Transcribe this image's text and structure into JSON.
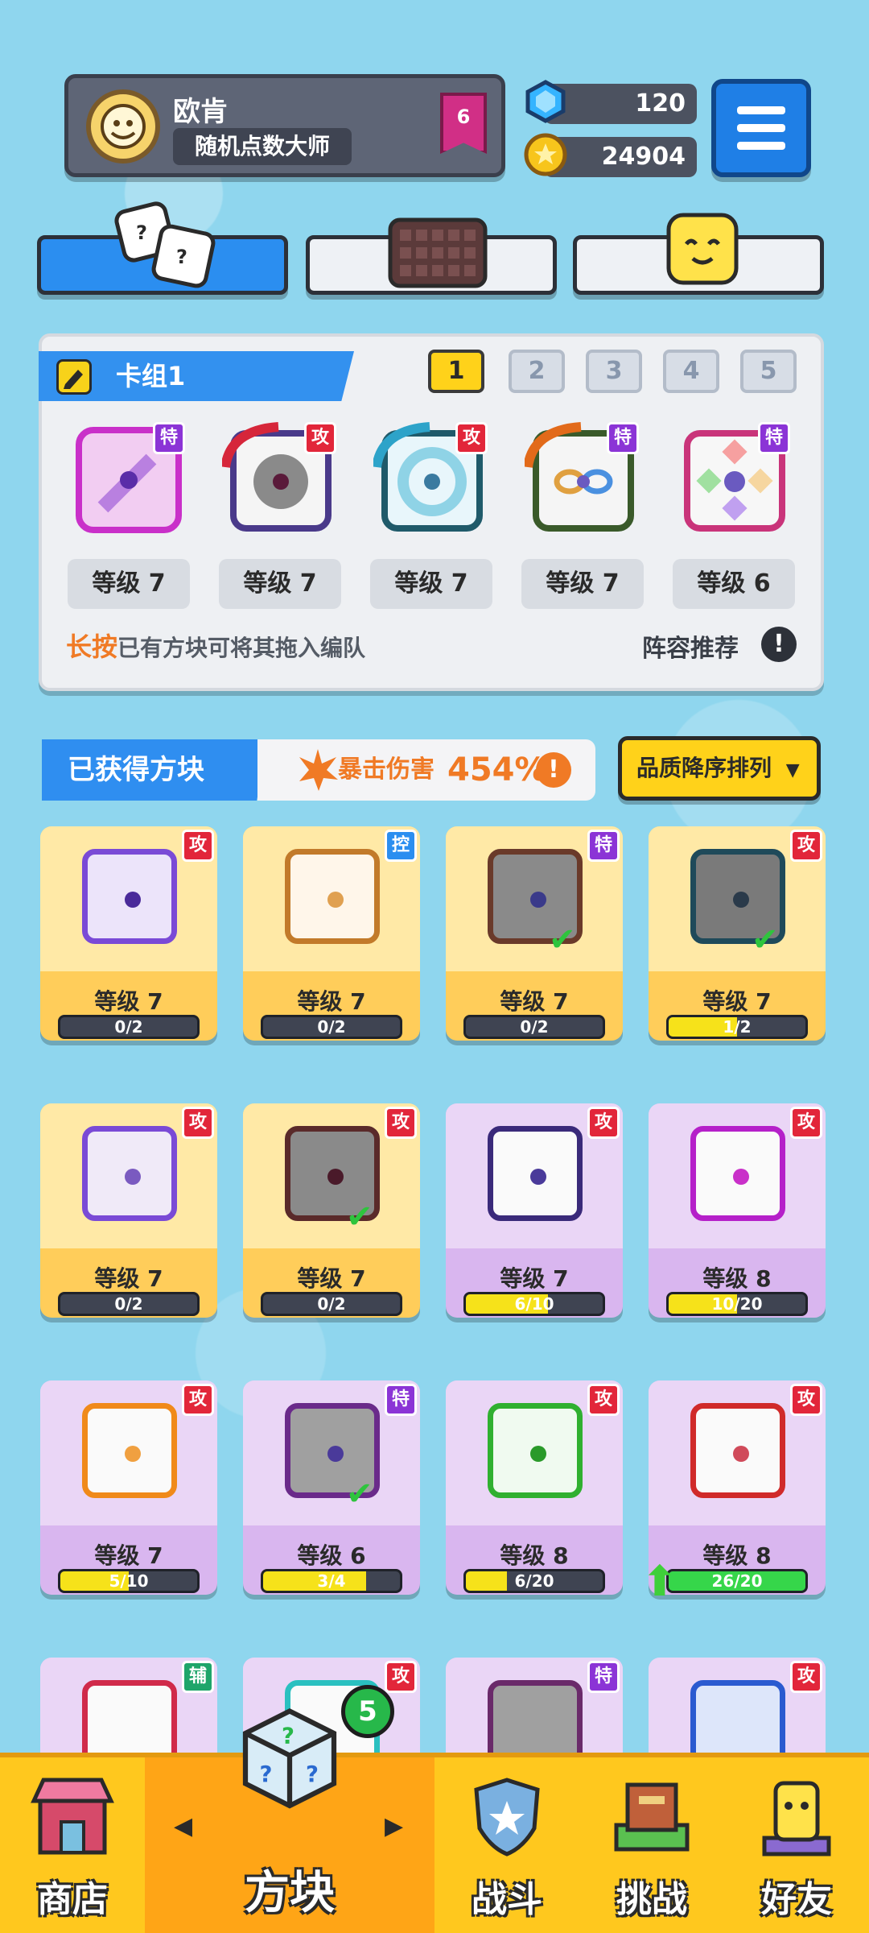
{
  "profile": {
    "name": "欧肯",
    "title": "随机点数大师",
    "rank": "6"
  },
  "currency": {
    "gems": "120",
    "gold": "24904"
  },
  "deck": {
    "title": "卡组1",
    "tabs": [
      "1",
      "2",
      "3",
      "4",
      "5"
    ],
    "active_tab": "1",
    "slots": [
      {
        "tag": "特",
        "level": "等级 7"
      },
      {
        "tag": "攻",
        "level": "等级 7"
      },
      {
        "tag": "攻",
        "level": "等级 7"
      },
      {
        "tag": "特",
        "level": "等级 7"
      },
      {
        "tag": "特",
        "level": "等级 6"
      }
    ],
    "hint_bold": "长按",
    "hint_rest": "已有方块可将其拖入编队",
    "lineup": "阵容推荐",
    "info_glyph": "!"
  },
  "obtained": {
    "title": "已获得方块",
    "crit_label": "暴击伤害",
    "crit_value": "454%",
    "info_glyph": "!",
    "sort": "品质降序排列",
    "sort_arrow": "▼"
  },
  "cards": [
    {
      "tag": "攻",
      "level": "等级 7",
      "progress": "0/2",
      "fill": 0
    },
    {
      "tag": "控",
      "level": "等级 7",
      "progress": "0/2",
      "fill": 0
    },
    {
      "tag": "特",
      "level": "等级 7",
      "progress": "0/2",
      "fill": 0
    },
    {
      "tag": "攻",
      "level": "等级 7",
      "progress": "1/2",
      "fill": 0.5
    },
    {
      "tag": "攻",
      "level": "等级 7",
      "progress": "0/2",
      "fill": 0
    },
    {
      "tag": "攻",
      "level": "等级 7",
      "progress": "0/2",
      "fill": 0
    },
    {
      "tag": "攻",
      "level": "等级 7",
      "progress": "6/10",
      "fill": 0.6
    },
    {
      "tag": "攻",
      "level": "等级 8",
      "progress": "10/20",
      "fill": 0.5
    },
    {
      "tag": "攻",
      "level": "等级 7",
      "progress": "5/10",
      "fill": 0.5
    },
    {
      "tag": "特",
      "level": "等级 6",
      "progress": "3/4",
      "fill": 0.75
    },
    {
      "tag": "攻",
      "level": "等级 8",
      "progress": "6/20",
      "fill": 0.3
    },
    {
      "tag": "攻",
      "level": "等级 8",
      "progress": "26/20",
      "fill": 1
    },
    {
      "tag": "辅"
    },
    {
      "tag": "攻"
    },
    {
      "tag": "特"
    },
    {
      "tag": "攻"
    }
  ],
  "nav": {
    "shop": "商店",
    "dice": "方块",
    "battle": "战斗",
    "challenge": "挑战",
    "friends": "好友",
    "dice_badge": "5",
    "prev_arrow": "◀",
    "next_arrow": "▶"
  },
  "colors": {
    "background": "#8fd6ee",
    "accent_blue": "#2b8ef0",
    "accent_yellow": "#ffd21a",
    "attack_tag": "#e2263a",
    "special_tag": "#8b34d6",
    "control_tag": "#2b8ef0",
    "support_tag": "#1ea56a"
  }
}
